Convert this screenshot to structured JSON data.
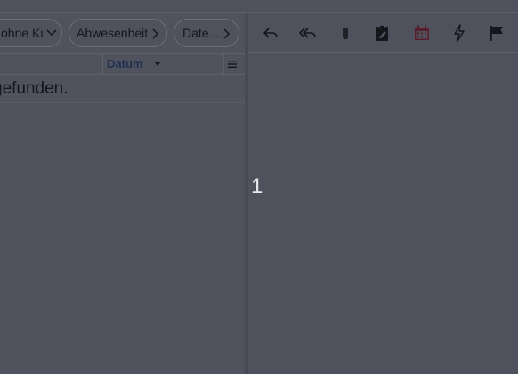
{
  "filters": {
    "chip_1_label": "ohne Kurs",
    "chip_2_label": "Abwesenheit",
    "chip_3_label": "Date..."
  },
  "list": {
    "column_date": "Datum",
    "empty_message": "gefunden."
  },
  "toolbar": {
    "icons": [
      "reply-icon",
      "reply-all-icon",
      "attachment-icon",
      "clipboard-edit-icon",
      "calendar-icon",
      "lightning-icon",
      "flag-icon"
    ],
    "colors": {
      "default_icon": "#14161c",
      "accent": "#5a1d2e"
    }
  },
  "overlay": {
    "page_number": "1"
  }
}
